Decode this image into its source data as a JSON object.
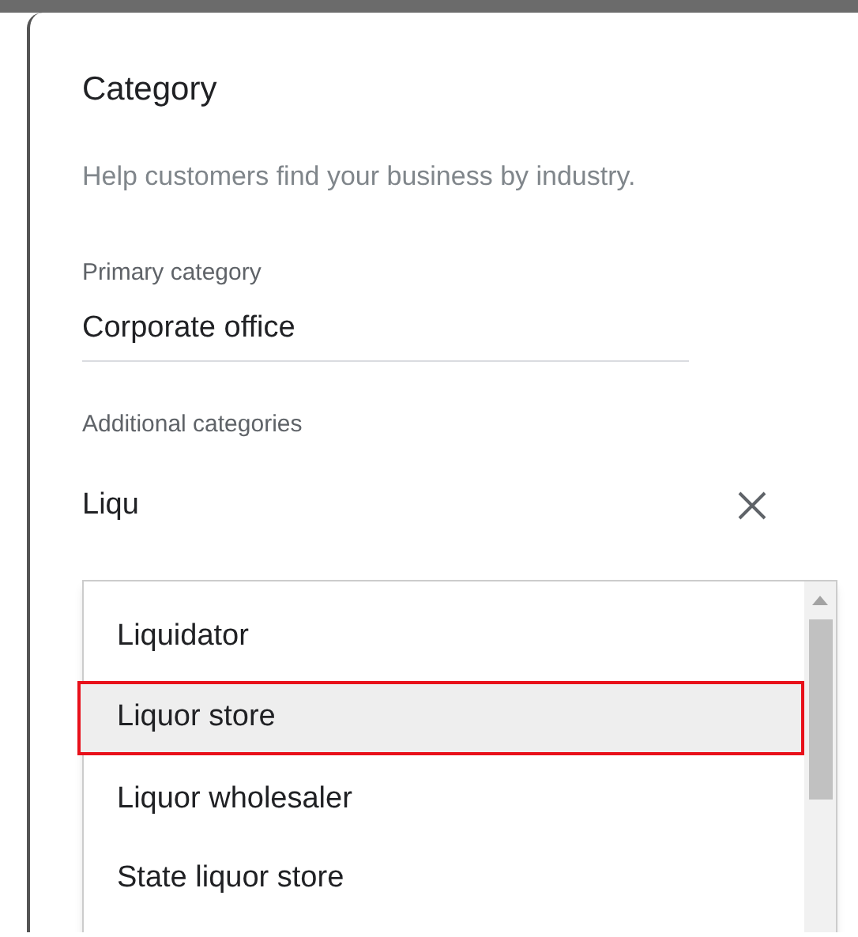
{
  "dialog": {
    "title": "Category",
    "description": "Help customers find your business by industry."
  },
  "primary_category": {
    "label": "Primary category",
    "value": "Corporate office"
  },
  "additional_categories": {
    "label": "Additional categories",
    "value": "Liqu"
  },
  "suggestions": [
    {
      "label": "Liquidator",
      "selected": false
    },
    {
      "label": "Liquor store",
      "selected": true
    },
    {
      "label": "Liquor wholesaler",
      "selected": false
    },
    {
      "label": "State liquor store",
      "selected": false
    }
  ]
}
